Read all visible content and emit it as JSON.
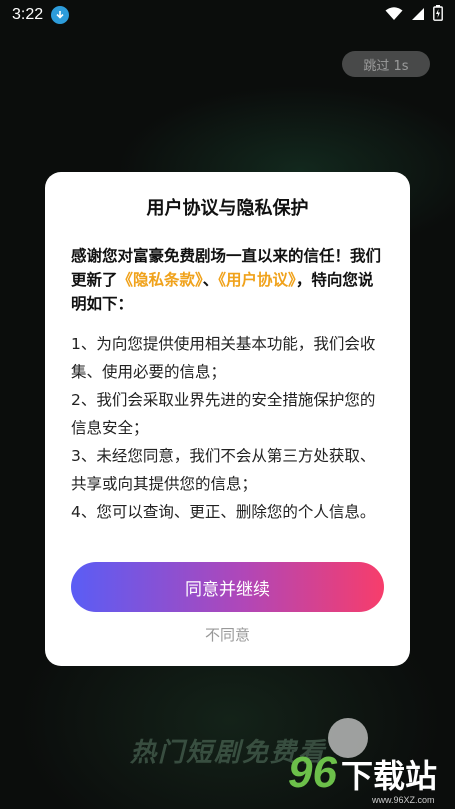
{
  "status_bar": {
    "time": "3:22",
    "icons": [
      "download-icon",
      "wifi-icon",
      "signal-icon",
      "battery-icon"
    ]
  },
  "skip_button": {
    "label": "跳过 1s"
  },
  "dialog": {
    "title": "用户协议与隐私保护",
    "intro_prefix": "感谢您对富豪免费剧场一直以来的信任！我们更新了",
    "privacy_link": "《隐私条款》",
    "intro_sep": "、",
    "user_link": "《用户协议》",
    "intro_suffix": "，特向您说明如下：",
    "clauses": [
      "1、为向您提供使用相关基本功能，我们会收集、使用必要的信息；",
      "2、我们会采取业界先进的安全措施保护您的信息安全；",
      "3、未经您同意，我们不会从第三方处获取、共享或向其提供您的信息；",
      "4、您可以查询、更正、删除您的个人信息。"
    ],
    "agree_label": "同意并继续",
    "disagree_label": "不同意"
  },
  "background": {
    "banner_text": "热门短剧免费看",
    "watermark_num": "96",
    "watermark_text": "下载站",
    "watermark_url": "www.96XZ.com"
  },
  "colors": {
    "link": "#f0a21b",
    "button_gradient_start": "#5a5df5",
    "button_gradient_end": "#f73d6b"
  }
}
